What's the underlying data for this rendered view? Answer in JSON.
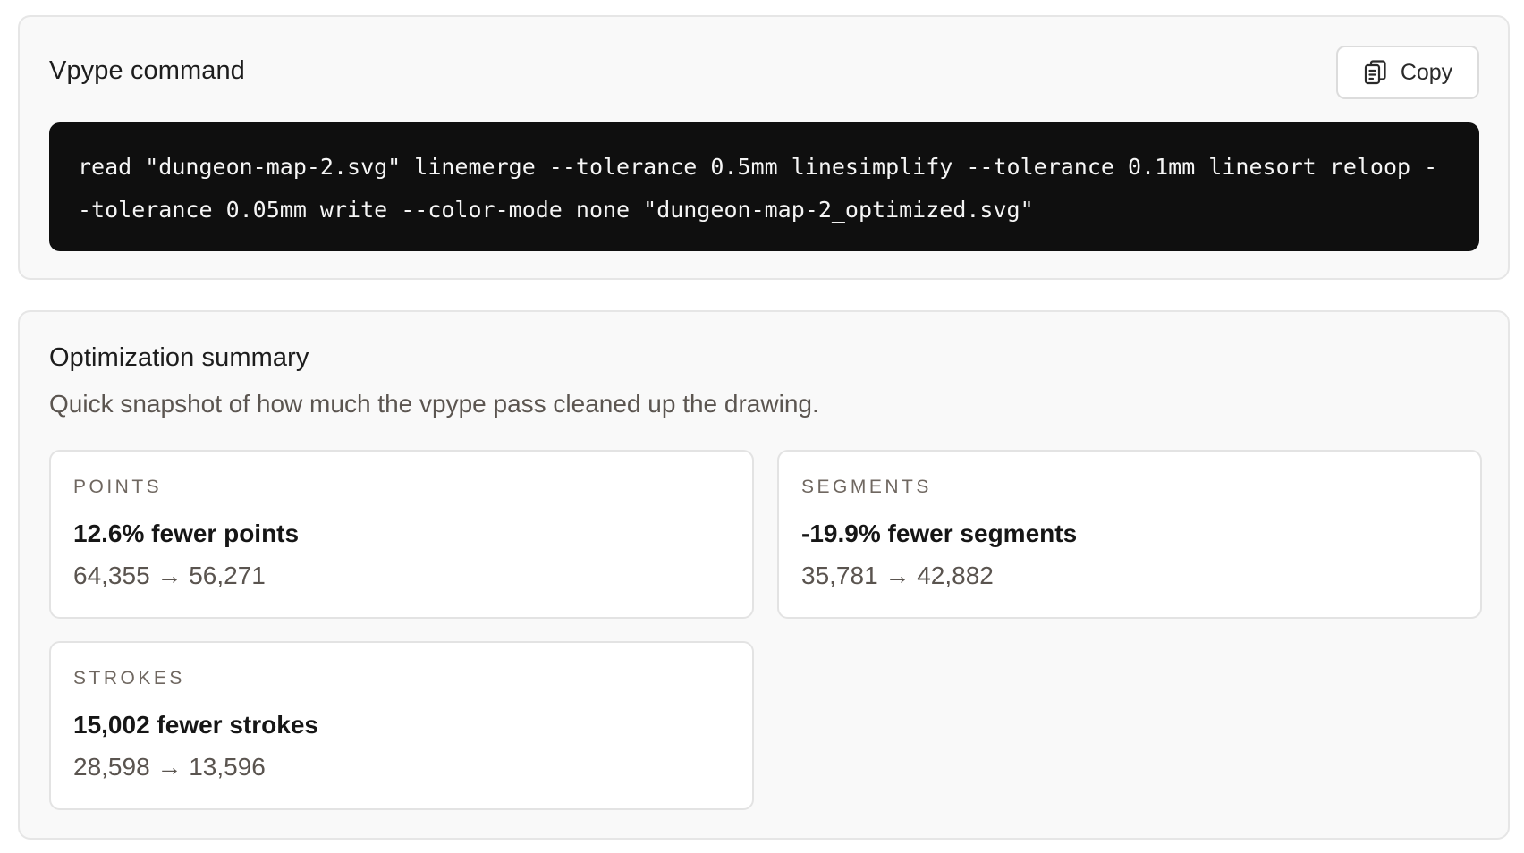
{
  "command_panel": {
    "title": "Vpype command",
    "copy_label": "Copy",
    "command": "read \"dungeon-map-2.svg\" linemerge --tolerance 0.5mm linesimplify --tolerance 0.1mm linesort reloop --tolerance 0.05mm write --color-mode none \"dungeon-map-2_optimized.svg\""
  },
  "summary_panel": {
    "title": "Optimization summary",
    "subtitle": "Quick snapshot of how much the vpype pass cleaned up the drawing.",
    "cards": [
      {
        "label": "POINTS",
        "headline": "12.6% fewer points",
        "detail": "64,355 → 56,271"
      },
      {
        "label": "SEGMENTS",
        "headline": "-19.9% fewer segments",
        "detail": "35,781 → 42,882"
      },
      {
        "label": "STROKES",
        "headline": "15,002 fewer strokes",
        "detail": "28,598 → 13,596"
      }
    ]
  },
  "icons": {
    "copy": "clipboard-copy-icon"
  }
}
